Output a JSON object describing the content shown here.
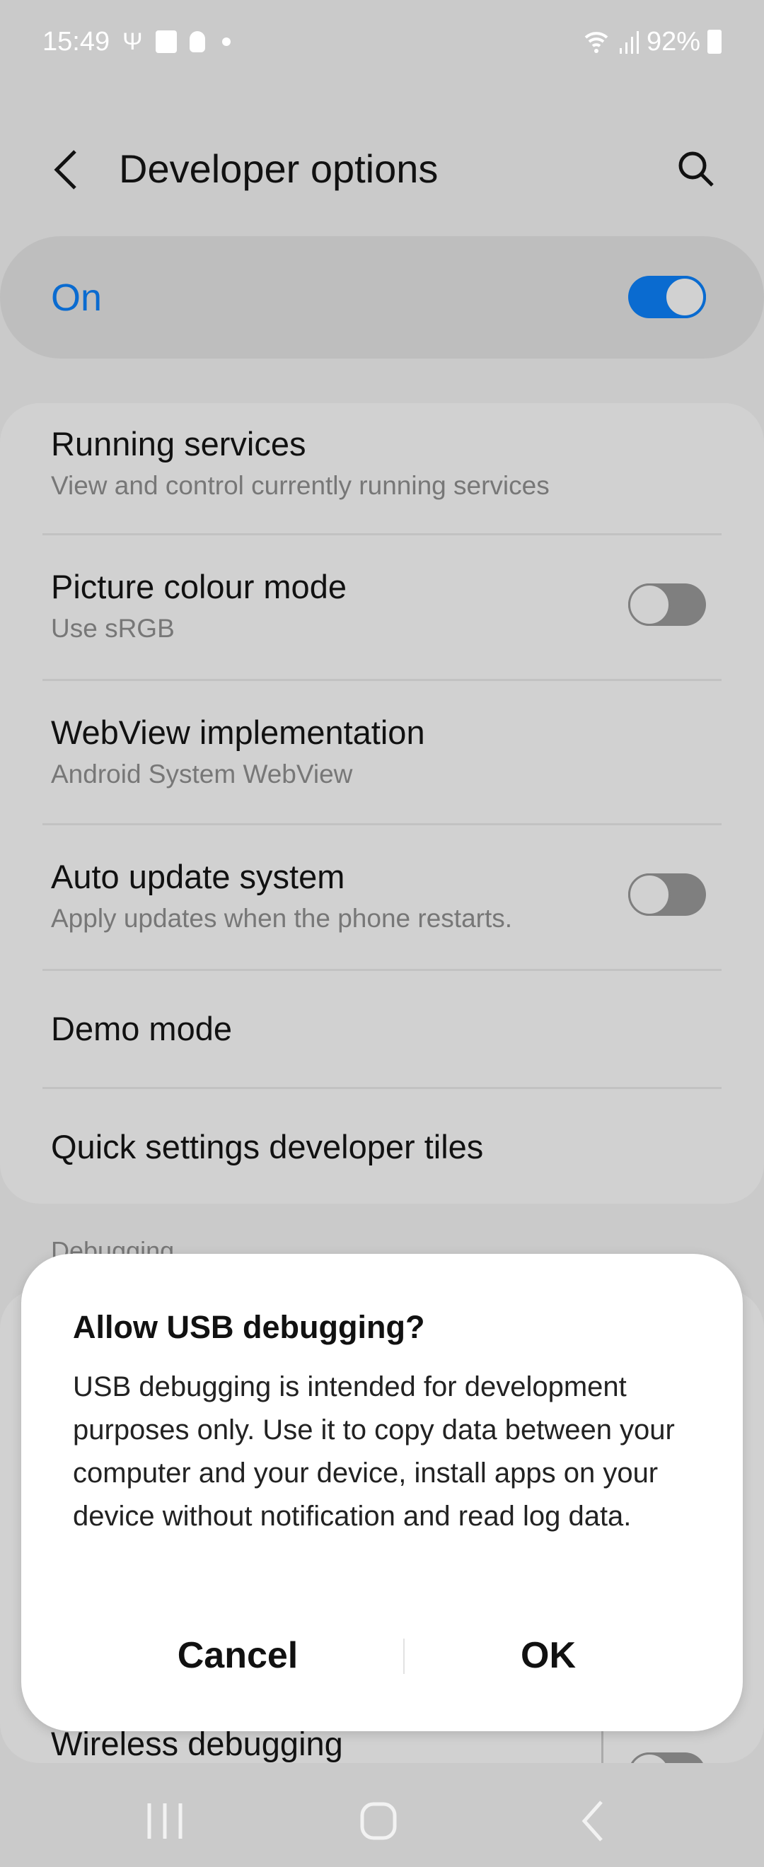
{
  "status_bar": {
    "time": "15:49",
    "battery": "92%",
    "icons": [
      "usb-icon",
      "gallery-icon",
      "bulb-icon",
      "dot-icon",
      "wifi-icon",
      "signal-icon",
      "battery-icon"
    ]
  },
  "header": {
    "title": "Developer options",
    "back_icon": "back-arrow-icon",
    "search_icon": "search-icon"
  },
  "master": {
    "label": "On",
    "enabled": true
  },
  "colors": {
    "accent": "#0a6bd0",
    "background": "#cacaca"
  },
  "items": [
    {
      "title": "Running services",
      "subtitle": "View and control currently running services"
    },
    {
      "title": "Picture colour mode",
      "subtitle": "Use sRGB",
      "toggle": false
    },
    {
      "title": "WebView implementation",
      "subtitle": "Android System WebView"
    },
    {
      "title": "Auto update system",
      "subtitle": "Apply updates when the phone restarts.",
      "toggle": false
    },
    {
      "title": "Demo mode"
    },
    {
      "title": "Quick settings developer tiles"
    }
  ],
  "section": {
    "debugging": "Debugging",
    "wireless": "Wireless debugging"
  },
  "dialog": {
    "title": "Allow USB debugging?",
    "body": "USB debugging is intended for development purposes only. Use it to copy data between your computer and your device, install apps on your device without notification and read log data.",
    "cancel": "Cancel",
    "ok": "OK"
  }
}
